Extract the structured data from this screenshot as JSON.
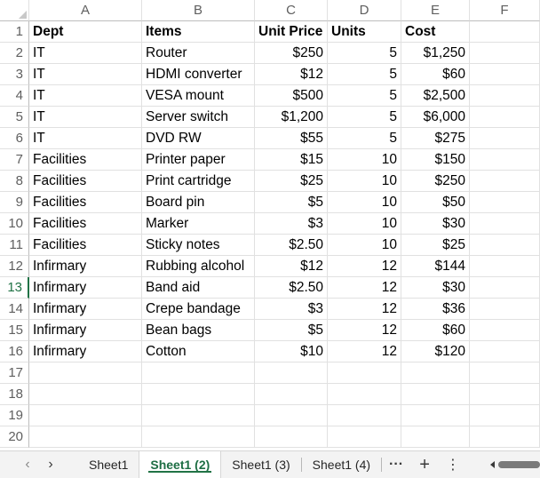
{
  "columns": [
    "A",
    "B",
    "C",
    "D",
    "E",
    "F"
  ],
  "header_row": {
    "num": "1",
    "dept": "Dept",
    "items": "Items",
    "price": "Unit Price",
    "units": "Units",
    "cost": "Cost"
  },
  "rows": [
    {
      "num": "2",
      "dept": "IT",
      "items": "Router",
      "price": "$250",
      "units": "5",
      "cost": "$1,250"
    },
    {
      "num": "3",
      "dept": "IT",
      "items": "HDMI converter",
      "price": "$12",
      "units": "5",
      "cost": "$60"
    },
    {
      "num": "4",
      "dept": "IT",
      "items": "VESA mount",
      "price": "$500",
      "units": "5",
      "cost": "$2,500"
    },
    {
      "num": "5",
      "dept": "IT",
      "items": "Server switch",
      "price": "$1,200",
      "units": "5",
      "cost": "$6,000"
    },
    {
      "num": "6",
      "dept": "IT",
      "items": "DVD RW",
      "price": "$55",
      "units": "5",
      "cost": "$275"
    },
    {
      "num": "7",
      "dept": "Facilities",
      "items": "Printer paper",
      "price": "$15",
      "units": "10",
      "cost": "$150"
    },
    {
      "num": "8",
      "dept": "Facilities",
      "items": "Print cartridge",
      "price": "$25",
      "units": "10",
      "cost": "$250"
    },
    {
      "num": "9",
      "dept": "Facilities",
      "items": "Board pin",
      "price": "$5",
      "units": "10",
      "cost": "$50"
    },
    {
      "num": "10",
      "dept": "Facilities",
      "items": "Marker",
      "price": "$3",
      "units": "10",
      "cost": "$30"
    },
    {
      "num": "11",
      "dept": "Facilities",
      "items": "Sticky notes",
      "price": "$2.50",
      "units": "10",
      "cost": "$25"
    },
    {
      "num": "12",
      "dept": "Infirmary",
      "items": "Rubbing alcohol",
      "price": "$12",
      "units": "12",
      "cost": "$144"
    },
    {
      "num": "13",
      "dept": "Infirmary",
      "items": "Band aid",
      "price": "$2.50",
      "units": "12",
      "cost": "$30"
    },
    {
      "num": "14",
      "dept": "Infirmary",
      "items": "Crepe bandage",
      "price": "$3",
      "units": "12",
      "cost": "$36"
    },
    {
      "num": "15",
      "dept": "Infirmary",
      "items": "Bean bags",
      "price": "$5",
      "units": "12",
      "cost": "$60"
    },
    {
      "num": "16",
      "dept": "Infirmary",
      "items": "Cotton",
      "price": "$10",
      "units": "12",
      "cost": "$120"
    }
  ],
  "empty_rows": [
    "17",
    "18",
    "19",
    "20"
  ],
  "active_row": "13",
  "tabs": {
    "prev": "‹",
    "next": "›",
    "items": [
      {
        "label": "Sheet1",
        "active": false
      },
      {
        "label": "Sheet1 (2)",
        "active": true
      },
      {
        "label": "Sheet1 (3)",
        "active": false
      },
      {
        "label": "Sheet1 (4)",
        "active": false
      }
    ],
    "more": "···",
    "add": "+",
    "options": "⋮"
  },
  "colors": {
    "accent": "#217346",
    "gridline": "#e1e1e1",
    "header_text": "#5f5f5f"
  }
}
